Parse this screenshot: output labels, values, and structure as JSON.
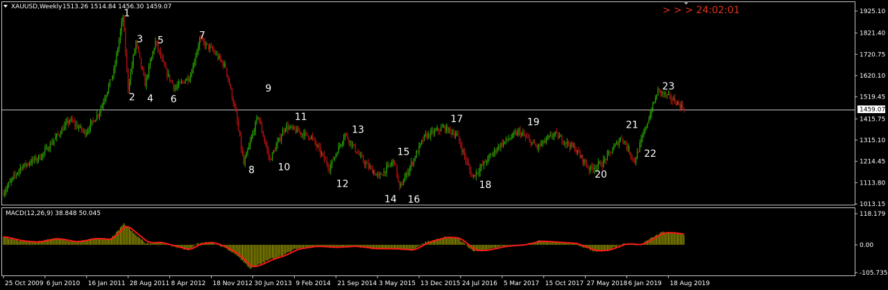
{
  "header": {
    "symbol": "XAUUSD,Weekly",
    "ohlc": "1513.26 1514.84 1456.30 1459.07",
    "timer": "> > > 24:02:01"
  },
  "colors": {
    "background": "#000000",
    "bull": "#2db200",
    "bear": "#c81414",
    "histogram": "#b4b400",
    "signal": "#ff1a1a",
    "grid_line": "#c8c8c8",
    "timer": "#e0341a"
  },
  "chart_data": [
    {
      "type": "candlestick",
      "title": "XAUUSD,Weekly",
      "ylim": [
        1013.25,
        1925.1
      ],
      "yticks": [
        {
          "value": 1925.1,
          "label": "1925.10"
        },
        {
          "value": 1821.4,
          "label": "1821.40"
        },
        {
          "value": 1720.75,
          "label": "1720.75"
        },
        {
          "value": 1620.1,
          "label": "1620.10"
        },
        {
          "value": 1519.45,
          "label": "1519.45"
        },
        {
          "value": 1415.75,
          "label": "1415.75"
        },
        {
          "value": 1315.1,
          "label": "1315.10"
        },
        {
          "value": 1214.45,
          "label": "1214.45"
        },
        {
          "value": 1113.8,
          "label": "1113.80"
        },
        {
          "value": 1013.15,
          "label": "1013.15"
        }
      ],
      "current_price": {
        "value": 1459.07,
        "label": "1459.07"
      },
      "xticks": [
        {
          "label": "25 Oct 2009",
          "index": 0
        },
        {
          "label": "6 Jun 2010",
          "index": 32
        },
        {
          "label": "16 Jan 2011",
          "index": 64
        },
        {
          "label": "28 Aug 2011",
          "index": 96
        },
        {
          "label": "8 Apr 2012",
          "index": 128
        },
        {
          "label": "18 Nov 2012",
          "index": 160
        },
        {
          "label": "30 Jun 2013",
          "index": 192
        },
        {
          "label": "9 Feb 2014",
          "index": 224
        },
        {
          "label": "21 Sep 2014",
          "index": 256
        },
        {
          "label": "3 May 2015",
          "index": 288
        },
        {
          "label": "13 Dec 2015",
          "index": 320
        },
        {
          "label": "24 Jul 2016",
          "index": 352
        },
        {
          "label": "5 Mar 2017",
          "index": 384
        },
        {
          "label": "15 Oct 2017",
          "index": 416
        },
        {
          "label": "27 May 2018",
          "index": 448
        },
        {
          "label": "6 Jan 2019",
          "index": 480
        },
        {
          "label": "18 Aug 2019",
          "index": 512
        }
      ],
      "anchors": [
        [
          0,
          1060
        ],
        [
          14,
          1185
        ],
        [
          30,
          1240
        ],
        [
          52,
          1410
        ],
        [
          64,
          1350
        ],
        [
          75,
          1450
        ],
        [
          86,
          1640
        ],
        [
          93,
          1900
        ],
        [
          97,
          1560
        ],
        [
          103,
          1780
        ],
        [
          110,
          1580
        ],
        [
          118,
          1780
        ],
        [
          126,
          1640
        ],
        [
          133,
          1560
        ],
        [
          145,
          1620
        ],
        [
          152,
          1790
        ],
        [
          162,
          1740
        ],
        [
          172,
          1660
        ],
        [
          180,
          1440
        ],
        [
          186,
          1200
        ],
        [
          197,
          1430
        ],
        [
          206,
          1220
        ],
        [
          218,
          1380
        ],
        [
          238,
          1330
        ],
        [
          252,
          1185
        ],
        [
          264,
          1345
        ],
        [
          278,
          1215
        ],
        [
          290,
          1140
        ],
        [
          302,
          1220
        ],
        [
          306,
          1085
        ],
        [
          325,
          1330
        ],
        [
          340,
          1375
        ],
        [
          350,
          1340
        ],
        [
          362,
          1140
        ],
        [
          383,
          1290
        ],
        [
          398,
          1355
        ],
        [
          412,
          1280
        ],
        [
          425,
          1345
        ],
        [
          441,
          1275
        ],
        [
          452,
          1180
        ],
        [
          462,
          1205
        ],
        [
          477,
          1330
        ],
        [
          487,
          1215
        ],
        [
          499,
          1440
        ],
        [
          505,
          1550
        ],
        [
          518,
          1500
        ],
        [
          524,
          1470
        ]
      ],
      "wave_labels": [
        {
          "label": "1",
          "index": 95,
          "price": 1900
        },
        {
          "label": "2",
          "index": 99,
          "price": 1503
        },
        {
          "label": "3",
          "index": 105,
          "price": 1777
        },
        {
          "label": "4",
          "index": 113,
          "price": 1497
        },
        {
          "label": "5",
          "index": 121,
          "price": 1772
        },
        {
          "label": "6",
          "index": 131,
          "price": 1494
        },
        {
          "label": "7",
          "index": 153,
          "price": 1795
        },
        {
          "label": "8",
          "index": 191,
          "price": 1160
        },
        {
          "label": "9",
          "index": 204,
          "price": 1545
        },
        {
          "label": "10",
          "index": 216,
          "price": 1173
        },
        {
          "label": "11",
          "index": 229,
          "price": 1410
        },
        {
          "label": "12",
          "index": 261,
          "price": 1094
        },
        {
          "label": "13",
          "index": 273,
          "price": 1350
        },
        {
          "label": "14",
          "index": 298,
          "price": 1022
        },
        {
          "label": "15",
          "index": 308,
          "price": 1245
        },
        {
          "label": "16",
          "index": 316,
          "price": 1020
        },
        {
          "label": "17",
          "index": 349,
          "price": 1400
        },
        {
          "label": "18",
          "index": 371,
          "price": 1088
        },
        {
          "label": "19",
          "index": 408,
          "price": 1385
        },
        {
          "label": "20",
          "index": 460,
          "price": 1138
        },
        {
          "label": "21",
          "index": 484,
          "price": 1372
        },
        {
          "label": "22",
          "index": 498,
          "price": 1237
        },
        {
          "label": "23",
          "index": 512,
          "price": 1555
        }
      ]
    },
    {
      "type": "bar",
      "title": "MACD(12,26,9) 38.848 50.045",
      "ylim": [
        -105.735,
        118.179
      ],
      "yticks": [
        {
          "value": 118.179,
          "label": "118.179"
        },
        {
          "value": 0,
          "label": "0.00"
        },
        {
          "value": -105.735,
          "label": "-105.735"
        }
      ],
      "anchors": [
        [
          0,
          30
        ],
        [
          12,
          15
        ],
        [
          25,
          10
        ],
        [
          40,
          25
        ],
        [
          55,
          10
        ],
        [
          70,
          25
        ],
        [
          82,
          20
        ],
        [
          93,
          80
        ],
        [
          100,
          45
        ],
        [
          110,
          5
        ],
        [
          120,
          10
        ],
        [
          130,
          -5
        ],
        [
          142,
          -20
        ],
        [
          150,
          5
        ],
        [
          160,
          10
        ],
        [
          170,
          -10
        ],
        [
          180,
          -40
        ],
        [
          190,
          -90
        ],
        [
          197,
          -75
        ],
        [
          205,
          -55
        ],
        [
          215,
          -40
        ],
        [
          225,
          -15
        ],
        [
          240,
          -5
        ],
        [
          255,
          -10
        ],
        [
          270,
          -5
        ],
        [
          285,
          -15
        ],
        [
          300,
          -15
        ],
        [
          315,
          -20
        ],
        [
          325,
          10
        ],
        [
          340,
          30
        ],
        [
          350,
          25
        ],
        [
          362,
          -25
        ],
        [
          372,
          -20
        ],
        [
          385,
          -5
        ],
        [
          400,
          0
        ],
        [
          412,
          15
        ],
        [
          425,
          10
        ],
        [
          440,
          5
        ],
        [
          455,
          -25
        ],
        [
          465,
          -20
        ],
        [
          478,
          5
        ],
        [
          490,
          0
        ],
        [
          497,
          20
        ],
        [
          507,
          48
        ],
        [
          516,
          45
        ],
        [
          524,
          39
        ]
      ]
    }
  ]
}
